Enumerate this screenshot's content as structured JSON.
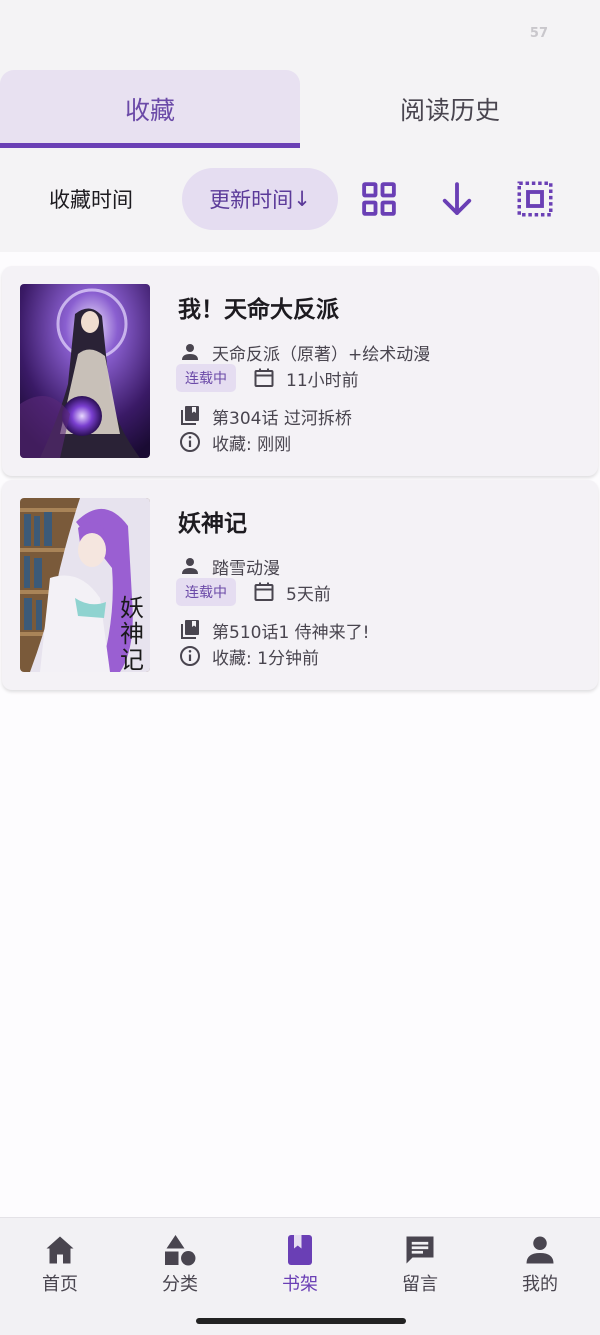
{
  "status_bar": {
    "battery": "57"
  },
  "tabs": [
    {
      "label": "收藏",
      "active": true
    },
    {
      "label": "阅读历史",
      "active": false
    }
  ],
  "sort": {
    "favorite_time": "收藏时间",
    "update_time": "更新时间",
    "arrow": "↓",
    "icons": [
      "grid-view-icon",
      "sort-descending-icon",
      "select-all-icon"
    ]
  },
  "books": [
    {
      "title": "我！天命大反派",
      "author": "天命反派（原著）+绘术动漫",
      "status": "连载中",
      "updated": "11小时前",
      "latest_chapter": "第304话 过河拆桥",
      "favorited": "收藏: 刚刚"
    },
    {
      "title": "妖神记",
      "author": "踏雪动漫",
      "status": "连载中",
      "updated": "5天前",
      "latest_chapter": "第510话1 侍神来了!",
      "favorited": "收藏: 1分钟前",
      "cover_text": "妖神记"
    }
  ],
  "bottom_nav": [
    {
      "label": "首页",
      "icon": "home-icon"
    },
    {
      "label": "分类",
      "icon": "shapes-icon"
    },
    {
      "label": "书架",
      "icon": "bookmark-book-icon",
      "active": true
    },
    {
      "label": "留言",
      "icon": "message-icon"
    },
    {
      "label": "我的",
      "icon": "person-icon"
    }
  ],
  "colors": {
    "accent": "#6a3fb5",
    "chip_bg": "#e5ddf1"
  }
}
